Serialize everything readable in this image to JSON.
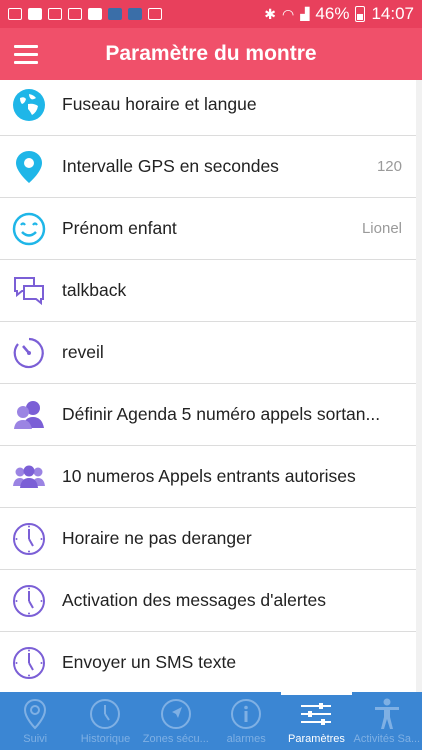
{
  "status_bar": {
    "battery": "46%",
    "time": "14:07"
  },
  "app_bar": {
    "title": "Paramètre du montre"
  },
  "settings": [
    {
      "label": "Fuseau horaire et langue",
      "value": "",
      "icon": "globe-icon"
    },
    {
      "label": "Intervalle GPS en secondes",
      "value": "120",
      "icon": "location-pin-icon"
    },
    {
      "label": "Prénom enfant",
      "value": "Lionel",
      "icon": "smiley-icon"
    },
    {
      "label": "talkback",
      "value": "",
      "icon": "chat-bubbles-icon"
    },
    {
      "label": "reveil",
      "value": "",
      "icon": "timer-icon"
    },
    {
      "label": "Définir Agenda 5 numéro appels sortan...",
      "value": "",
      "icon": "contacts-icon"
    },
    {
      "label": "10 numeros Appels entrants autorises",
      "value": "",
      "icon": "group-icon"
    },
    {
      "label": "Horaire ne pas deranger",
      "value": "",
      "icon": "clock-icon"
    },
    {
      "label": "Activation des messages d'alertes",
      "value": "",
      "icon": "clock-icon"
    },
    {
      "label": "Envoyer un SMS texte",
      "value": "",
      "icon": "clock-icon"
    }
  ],
  "tabs": [
    {
      "label": "Suivi",
      "icon": "location-pin-icon",
      "active": false
    },
    {
      "label": "Historique",
      "icon": "clock-icon",
      "active": false
    },
    {
      "label": "Zones sécu...",
      "icon": "navigation-arrow-icon",
      "active": false
    },
    {
      "label": "alarmes",
      "icon": "info-icon",
      "active": false
    },
    {
      "label": "Paramètres",
      "icon": "sliders-icon",
      "active": true
    },
    {
      "label": "Activités Sa...",
      "icon": "person-icon",
      "active": false
    }
  ],
  "colors": {
    "status_bar": "#e8405c",
    "app_bar": "#f0506a",
    "tab_bar": "#3b86d3",
    "icon_cyan": "#1fb6e8",
    "icon_purple": "#7b5fd6"
  }
}
